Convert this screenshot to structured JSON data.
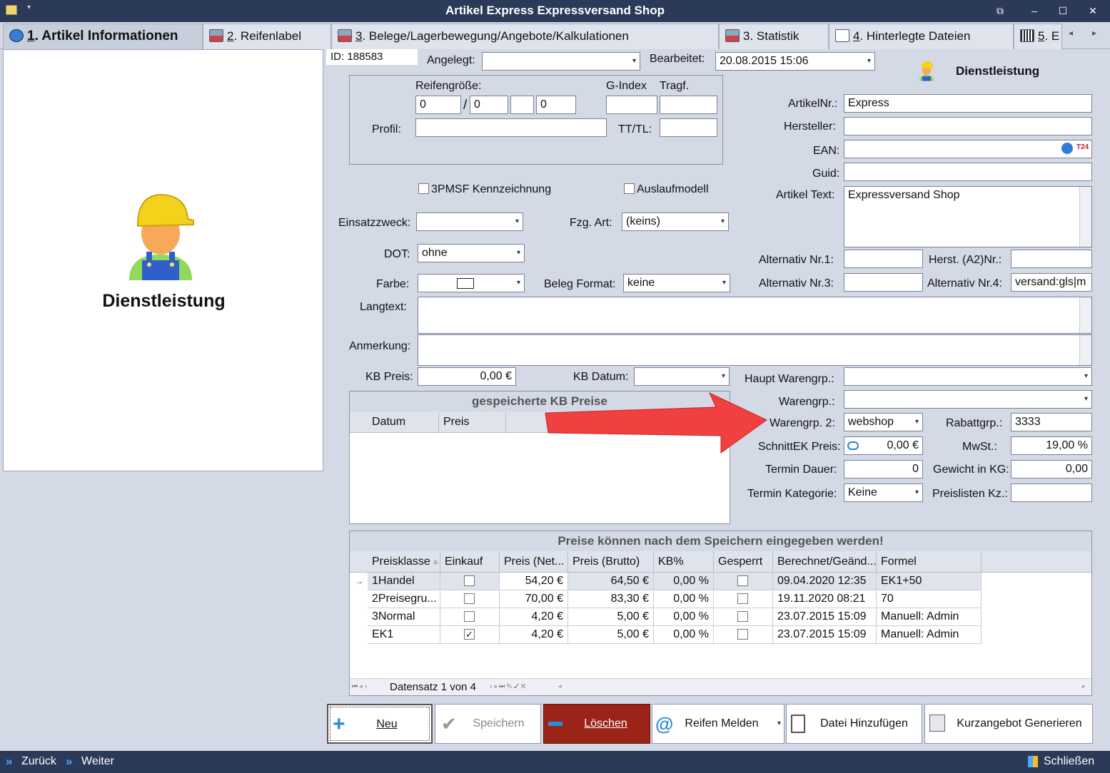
{
  "window": {
    "title": "Artikel Express Expressversand Shop"
  },
  "tabs": [
    {
      "num": "1",
      "label": ". Artikel Informationen"
    },
    {
      "num": "2",
      "label": ". Reifenlabel"
    },
    {
      "num": "3",
      "label": ". Belege/Lagerbewegung/Angebote/Kalkulationen"
    },
    {
      "num": "",
      "label": "3. Statistik"
    },
    {
      "num": "4",
      "label": ". Hinterlegte Dateien"
    },
    {
      "num": "5",
      "label": ". E"
    }
  ],
  "left": {
    "category_label": "Dienstleistung"
  },
  "header": {
    "id": "ID: 188583",
    "angelegt_label": "Angelegt:",
    "angelegt_value": "",
    "bearbeitet_label": "Bearbeitet:",
    "bearbeitet_value": "20.08.2015 15:06",
    "category": "Dienstleistung"
  },
  "tire": {
    "size_label": "Reifengröße:",
    "size": [
      "0",
      "0",
      "",
      "0"
    ],
    "slash": "/",
    "gindex_label": "G-Index",
    "gindex": "",
    "tragf_label": "Tragf.",
    "tragf": "",
    "profil_label": "Profil:",
    "profil": "",
    "tttl_label": "TT/TL:",
    "tttl": ""
  },
  "checks": {
    "pmsf_label": "3PMSF Kennzeichnung",
    "pmsf": false,
    "auslauf_label": "Auslaufmodell",
    "auslauf": false
  },
  "form": {
    "einsatz_label": "Einsatzzweck:",
    "einsatz": "",
    "fzg_label": "Fzg. Art:",
    "fzg": "(keins)",
    "dot_label": "DOT:",
    "dot": "ohne",
    "farbe_label": "Farbe:",
    "beleg_label": "Beleg Format:",
    "beleg": "keine",
    "langtext_label": "Langtext:",
    "langtext": "",
    "anmerkung_label": "Anmerkung:",
    "anmerkung": "",
    "kbpreis_label": "KB Preis:",
    "kbpreis": "0,00 €",
    "kbdatum_label": "KB Datum:",
    "kbdatum": ""
  },
  "right": {
    "artnr_label": "ArtikelNr.:",
    "artnr": "Express",
    "hersteller_label": "Hersteller:",
    "hersteller": "",
    "ean_label": "EAN:",
    "ean": "",
    "guid_label": "Guid:",
    "guid": "",
    "text_label": "Artikel Text:",
    "text": "Expressversand Shop",
    "alt1_label": "Alternativ Nr.1:",
    "alt1": "",
    "herst_a2_label": "Herst. (A2)Nr.:",
    "herst_a2": "",
    "alt3_label": "Alternativ Nr.3:",
    "alt3": "",
    "alt4_label": "Alternativ Nr.4:",
    "alt4": "versand:gls|m",
    "hauptwg_label": "Haupt Warengrp.:",
    "hauptwg": "",
    "wg_label": "Warengrp.:",
    "wg": "",
    "wg2_label": "Warengrp. 2:",
    "wg2": "webshop",
    "rabatt_label": "Rabattgrp.:",
    "rabatt": "3333",
    "schnitt_label": "SchnittEK Preis:",
    "schnitt": "0,00 €",
    "mwst_label": "MwSt.:",
    "mwst": "19,00 %",
    "termin_label": "Termin Dauer:",
    "termin": "0",
    "gewicht_label": "Gewicht in KG:",
    "gewicht": "0,00",
    "terminkat_label": "Termin Kategorie:",
    "terminkat": "Keine",
    "preisliste_label": "Preislisten Kz.:",
    "preisliste": ""
  },
  "kbgrid": {
    "title": "gespeicherte KB Preise",
    "cols": [
      "Datum",
      "Preis"
    ]
  },
  "prices": {
    "title": "Preise können nach dem Speichern eingegeben werden!",
    "cols": [
      "Preisklasse",
      "Einkauf",
      "Preis (Net...",
      "Preis (Brutto)",
      "KB%",
      "Gesperrt",
      "Berechnet/Geänd...",
      "Formel"
    ],
    "rows": [
      {
        "klasse": "1Handel",
        "einkauf": false,
        "netto": "54,20 €",
        "brutto": "64,50 €",
        "kb": "0,00 %",
        "gesperrt": false,
        "datum": "09.04.2020 12:35",
        "formel": "EK1+50"
      },
      {
        "klasse": "2Preisegru...",
        "einkauf": false,
        "netto": "70,00 €",
        "brutto": "83,30 €",
        "kb": "0,00 %",
        "gesperrt": false,
        "datum": "19.11.2020 08:21",
        "formel": "70"
      },
      {
        "klasse": "3Normal",
        "einkauf": false,
        "netto": "4,20 €",
        "brutto": "5,00 €",
        "kb": "0,00 %",
        "gesperrt": false,
        "datum": "23.07.2015 15:09",
        "formel": "Manuell: Admin"
      },
      {
        "klasse": "EK1",
        "einkauf": true,
        "netto": "4,20 €",
        "brutto": "5,00 €",
        "kb": "0,00 %",
        "gesperrt": false,
        "datum": "23.07.2015 15:09",
        "formel": "Manuell: Admin"
      }
    ],
    "nav_text": "Datensatz 1 von 4"
  },
  "buttons": {
    "neu": "Neu",
    "speichern": "Speichern",
    "loeschen": "Löschen",
    "reifen": "Reifen Melden",
    "datei": "Datei Hinzufügen",
    "kurz": "Kurzangebot Generieren"
  },
  "status": {
    "zurueck": "Zurück",
    "weiter": "Weiter",
    "schliessen": "Schließen"
  },
  "colors": {
    "titlebar": "#2b3a58",
    "delete": "#9b2317",
    "arrow": "#f04040"
  }
}
